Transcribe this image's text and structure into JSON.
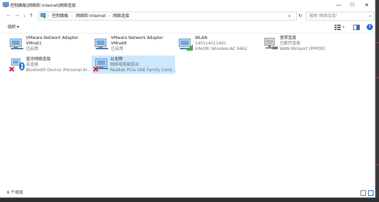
{
  "window": {
    "title": "控制面板\\网络和 Internet\\网络连接",
    "controls": {
      "minimize": "—",
      "maximize": "☐",
      "close": "✕"
    }
  },
  "address": {
    "breadcrumbs": [
      "控制面板",
      "网络和 Internet",
      "网络连接"
    ],
    "separator": "›",
    "dropdown": "∨",
    "refresh": "↻"
  },
  "search": {
    "placeholder": "搜索\"网络连接\""
  },
  "toolbar": {
    "organize": "组织 ▾"
  },
  "connections": [
    {
      "id": "vmnet1",
      "name": "VMware Network Adapter",
      "line1": "VMnet1",
      "line2": "已启用",
      "icon": "network-adapter-icon",
      "status": "enabled",
      "selected": false
    },
    {
      "id": "vmnet8",
      "name": "VMware Network Adapter",
      "line1": "VMnet8",
      "line2": "已启用",
      "icon": "network-adapter-icon",
      "status": "enabled",
      "selected": false
    },
    {
      "id": "wlan",
      "name": "WLAN",
      "line1": "140114011401",
      "line2": "Intel(R) Wireless-AC 9462",
      "icon": "wlan-adapter-icon",
      "status": "connected",
      "selected": false
    },
    {
      "id": "broadband",
      "name": "宽带连接",
      "line1": "已断开连接",
      "line2": "WAN Miniport (PPPOE)",
      "icon": "broadband-icon",
      "status": "disconnected",
      "selected": false
    },
    {
      "id": "bluetooth",
      "name": "蓝牙网络连接",
      "line1": "未连接",
      "line2": "Bluetooth Device (Personal Ar...",
      "icon": "bluetooth-adapter-icon",
      "status": "error",
      "selected": false
    },
    {
      "id": "ethernet",
      "name": "以太网",
      "line1": "网络电缆被拔出",
      "line2": "Realtek PCIe GbE Family Contr...",
      "icon": "ethernet-adapter-icon",
      "status": "error",
      "selected": true
    }
  ],
  "status": {
    "count": "6 个项目"
  },
  "colors": {
    "selection": "#cce8ff",
    "accent": "#1e6ac9",
    "error": "#e81123"
  }
}
